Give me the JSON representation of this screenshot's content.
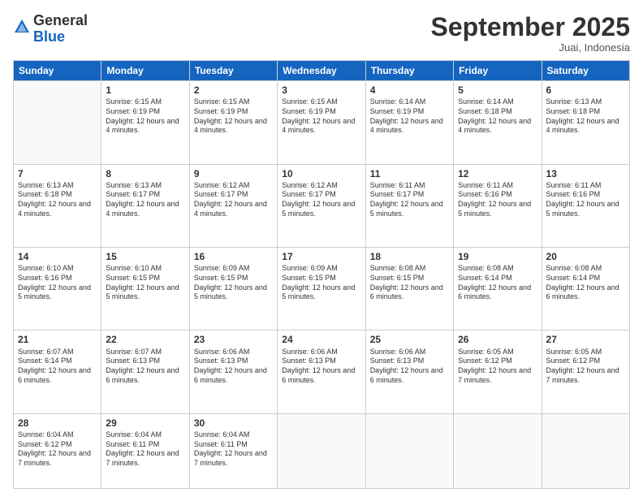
{
  "logo": {
    "general": "General",
    "blue": "Blue"
  },
  "header": {
    "month": "September 2025",
    "location": "Juai, Indonesia"
  },
  "days_of_week": [
    "Sunday",
    "Monday",
    "Tuesday",
    "Wednesday",
    "Thursday",
    "Friday",
    "Saturday"
  ],
  "weeks": [
    [
      {
        "day": "",
        "sunrise": "",
        "sunset": "",
        "daylight": ""
      },
      {
        "day": "1",
        "sunrise": "Sunrise: 6:15 AM",
        "sunset": "Sunset: 6:19 PM",
        "daylight": "Daylight: 12 hours and 4 minutes."
      },
      {
        "day": "2",
        "sunrise": "Sunrise: 6:15 AM",
        "sunset": "Sunset: 6:19 PM",
        "daylight": "Daylight: 12 hours and 4 minutes."
      },
      {
        "day": "3",
        "sunrise": "Sunrise: 6:15 AM",
        "sunset": "Sunset: 6:19 PM",
        "daylight": "Daylight: 12 hours and 4 minutes."
      },
      {
        "day": "4",
        "sunrise": "Sunrise: 6:14 AM",
        "sunset": "Sunset: 6:19 PM",
        "daylight": "Daylight: 12 hours and 4 minutes."
      },
      {
        "day": "5",
        "sunrise": "Sunrise: 6:14 AM",
        "sunset": "Sunset: 6:18 PM",
        "daylight": "Daylight: 12 hours and 4 minutes."
      },
      {
        "day": "6",
        "sunrise": "Sunrise: 6:13 AM",
        "sunset": "Sunset: 6:18 PM",
        "daylight": "Daylight: 12 hours and 4 minutes."
      }
    ],
    [
      {
        "day": "7",
        "sunrise": "Sunrise: 6:13 AM",
        "sunset": "Sunset: 6:18 PM",
        "daylight": "Daylight: 12 hours and 4 minutes."
      },
      {
        "day": "8",
        "sunrise": "Sunrise: 6:13 AM",
        "sunset": "Sunset: 6:17 PM",
        "daylight": "Daylight: 12 hours and 4 minutes."
      },
      {
        "day": "9",
        "sunrise": "Sunrise: 6:12 AM",
        "sunset": "Sunset: 6:17 PM",
        "daylight": "Daylight: 12 hours and 4 minutes."
      },
      {
        "day": "10",
        "sunrise": "Sunrise: 6:12 AM",
        "sunset": "Sunset: 6:17 PM",
        "daylight": "Daylight: 12 hours and 5 minutes."
      },
      {
        "day": "11",
        "sunrise": "Sunrise: 6:11 AM",
        "sunset": "Sunset: 6:17 PM",
        "daylight": "Daylight: 12 hours and 5 minutes."
      },
      {
        "day": "12",
        "sunrise": "Sunrise: 6:11 AM",
        "sunset": "Sunset: 6:16 PM",
        "daylight": "Daylight: 12 hours and 5 minutes."
      },
      {
        "day": "13",
        "sunrise": "Sunrise: 6:11 AM",
        "sunset": "Sunset: 6:16 PM",
        "daylight": "Daylight: 12 hours and 5 minutes."
      }
    ],
    [
      {
        "day": "14",
        "sunrise": "Sunrise: 6:10 AM",
        "sunset": "Sunset: 6:16 PM",
        "daylight": "Daylight: 12 hours and 5 minutes."
      },
      {
        "day": "15",
        "sunrise": "Sunrise: 6:10 AM",
        "sunset": "Sunset: 6:15 PM",
        "daylight": "Daylight: 12 hours and 5 minutes."
      },
      {
        "day": "16",
        "sunrise": "Sunrise: 6:09 AM",
        "sunset": "Sunset: 6:15 PM",
        "daylight": "Daylight: 12 hours and 5 minutes."
      },
      {
        "day": "17",
        "sunrise": "Sunrise: 6:09 AM",
        "sunset": "Sunset: 6:15 PM",
        "daylight": "Daylight: 12 hours and 5 minutes."
      },
      {
        "day": "18",
        "sunrise": "Sunrise: 6:08 AM",
        "sunset": "Sunset: 6:15 PM",
        "daylight": "Daylight: 12 hours and 6 minutes."
      },
      {
        "day": "19",
        "sunrise": "Sunrise: 6:08 AM",
        "sunset": "Sunset: 6:14 PM",
        "daylight": "Daylight: 12 hours and 6 minutes."
      },
      {
        "day": "20",
        "sunrise": "Sunrise: 6:08 AM",
        "sunset": "Sunset: 6:14 PM",
        "daylight": "Daylight: 12 hours and 6 minutes."
      }
    ],
    [
      {
        "day": "21",
        "sunrise": "Sunrise: 6:07 AM",
        "sunset": "Sunset: 6:14 PM",
        "daylight": "Daylight: 12 hours and 6 minutes."
      },
      {
        "day": "22",
        "sunrise": "Sunrise: 6:07 AM",
        "sunset": "Sunset: 6:13 PM",
        "daylight": "Daylight: 12 hours and 6 minutes."
      },
      {
        "day": "23",
        "sunrise": "Sunrise: 6:06 AM",
        "sunset": "Sunset: 6:13 PM",
        "daylight": "Daylight: 12 hours and 6 minutes."
      },
      {
        "day": "24",
        "sunrise": "Sunrise: 6:06 AM",
        "sunset": "Sunset: 6:13 PM",
        "daylight": "Daylight: 12 hours and 6 minutes."
      },
      {
        "day": "25",
        "sunrise": "Sunrise: 6:06 AM",
        "sunset": "Sunset: 6:13 PM",
        "daylight": "Daylight: 12 hours and 6 minutes."
      },
      {
        "day": "26",
        "sunrise": "Sunrise: 6:05 AM",
        "sunset": "Sunset: 6:12 PM",
        "daylight": "Daylight: 12 hours and 7 minutes."
      },
      {
        "day": "27",
        "sunrise": "Sunrise: 6:05 AM",
        "sunset": "Sunset: 6:12 PM",
        "daylight": "Daylight: 12 hours and 7 minutes."
      }
    ],
    [
      {
        "day": "28",
        "sunrise": "Sunrise: 6:04 AM",
        "sunset": "Sunset: 6:12 PM",
        "daylight": "Daylight: 12 hours and 7 minutes."
      },
      {
        "day": "29",
        "sunrise": "Sunrise: 6:04 AM",
        "sunset": "Sunset: 6:11 PM",
        "daylight": "Daylight: 12 hours and 7 minutes."
      },
      {
        "day": "30",
        "sunrise": "Sunrise: 6:04 AM",
        "sunset": "Sunset: 6:11 PM",
        "daylight": "Daylight: 12 hours and 7 minutes."
      },
      {
        "day": "",
        "sunrise": "",
        "sunset": "",
        "daylight": ""
      },
      {
        "day": "",
        "sunrise": "",
        "sunset": "",
        "daylight": ""
      },
      {
        "day": "",
        "sunrise": "",
        "sunset": "",
        "daylight": ""
      },
      {
        "day": "",
        "sunrise": "",
        "sunset": "",
        "daylight": ""
      }
    ]
  ]
}
